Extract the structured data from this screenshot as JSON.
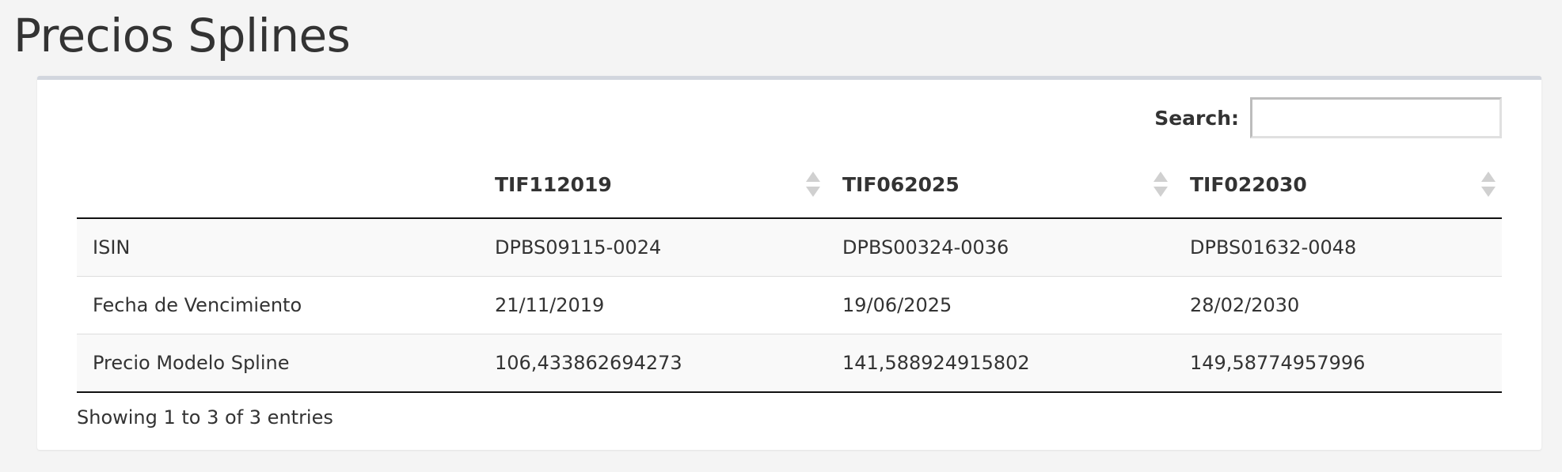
{
  "page": {
    "title": "Precios Splines"
  },
  "search": {
    "label": "Search:",
    "value": "",
    "placeholder": ""
  },
  "table": {
    "columns": [
      "",
      "TIF112019",
      "TIF062025",
      "TIF022030"
    ],
    "rows": [
      [
        "ISIN",
        "DPBS09115-0024",
        "DPBS00324-0036",
        "DPBS01632-0048"
      ],
      [
        "Fecha de Vencimiento",
        "21/11/2019",
        "19/06/2025",
        "28/02/2030"
      ],
      [
        "Precio Modelo Spline",
        "106,433862694273",
        "141,588924915802",
        "149,58774957996"
      ]
    ]
  },
  "info": {
    "text": "Showing 1 to 3 of 3 entries"
  },
  "colors": {
    "background": "#f4f4f4",
    "box_border": "#d2d6de",
    "stripe": "#f9f9f9",
    "text": "#333333"
  },
  "icons": {
    "sort": "sort-both-icon"
  }
}
